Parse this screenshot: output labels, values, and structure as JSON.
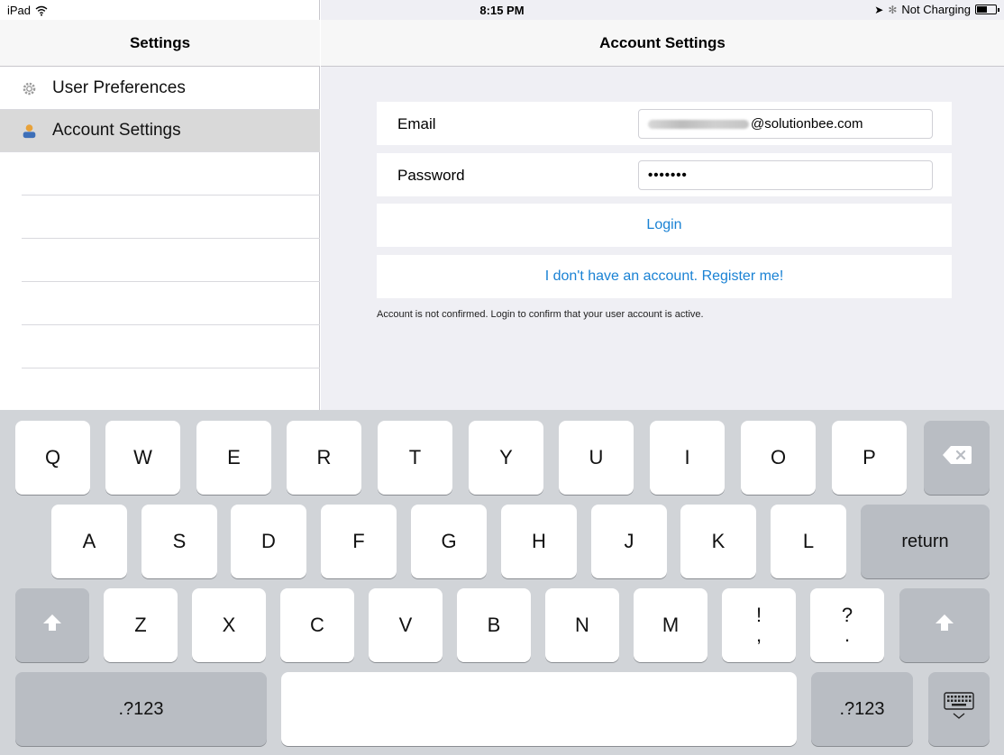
{
  "status_bar": {
    "device": "iPad",
    "time": "8:15 PM",
    "charging": "Not Charging"
  },
  "left_panel": {
    "title": "Settings",
    "items": [
      {
        "label": "User Preferences",
        "icon": "gear-icon"
      },
      {
        "label": "Account Settings",
        "icon": "person-icon",
        "selected": true
      }
    ]
  },
  "right_panel": {
    "title": "Account Settings",
    "email": {
      "label": "Email",
      "value_visible": "@solutionbee.com"
    },
    "password": {
      "label": "Password",
      "value": "•••••••"
    },
    "login_button": "Login",
    "register_button": "I don't have an account. Register me!",
    "note": "Account is not confirmed. Login to confirm that your user account is active."
  },
  "keyboard": {
    "row1": [
      "Q",
      "W",
      "E",
      "R",
      "T",
      "Y",
      "U",
      "I",
      "O",
      "P"
    ],
    "row2": [
      "A",
      "S",
      "D",
      "F",
      "G",
      "H",
      "J",
      "K",
      "L"
    ],
    "row3": [
      "Z",
      "X",
      "C",
      "V",
      "B",
      "N",
      "M"
    ],
    "exclam_top": "!",
    "exclam_bottom": ",",
    "question_top": "?",
    "question_bottom": ".",
    "return_label": "return",
    "numbers_label": ".?123",
    "delete_icon": "backspace-icon",
    "shift_icon": "shift-icon",
    "hide_keyboard_icon": "keyboard-hide-icon"
  },
  "colors": {
    "link_blue": "#1a82d4",
    "selected_row": "#d9d9d9",
    "content_bg": "#efeff4",
    "keyboard_bg": "#d1d4d8"
  }
}
